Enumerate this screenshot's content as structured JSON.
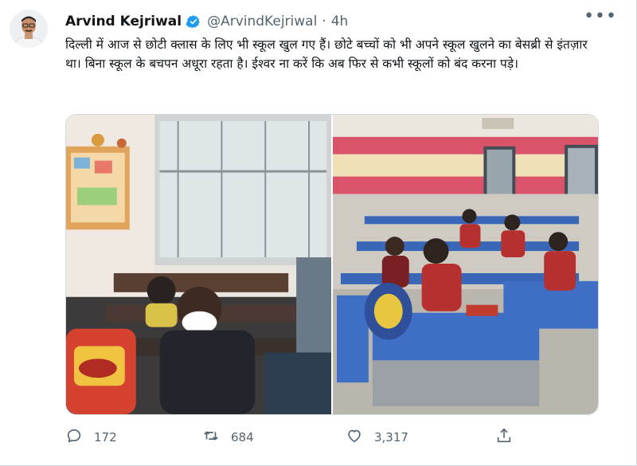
{
  "tweet": {
    "author_name": "Arvind Kejriwal",
    "handle": "@ArvindKejriwal",
    "separator": "·",
    "time": "4h",
    "more_label": "•••",
    "text": "दिल्ली में आज से छोटी क्लास के लिए भी स्कूल खुल गए हैं। छोटे बच्चों को भी अपने स्कूल खुलने का बेसब्री से इंतज़ार था। बिना स्कूल के बचपन अधूरा रहता है। ईश्वर ना करें कि अब फिर से कभी स्कूलों को बंद करना पड़े।",
    "images": [
      {
        "icon": "classroom-photo-left"
      },
      {
        "icon": "classroom-photo-right"
      }
    ]
  },
  "actions": {
    "replies": "172",
    "retweets": "684",
    "likes": "3,317"
  },
  "colors": {
    "accent": "#1d9bf0",
    "secondary_text": "#536471",
    "primary_text": "#0f1419"
  },
  "icons": {
    "verified": "verified-badge-icon",
    "reply": "reply-icon",
    "retweet": "retweet-icon",
    "like": "heart-icon",
    "share": "share-icon"
  }
}
